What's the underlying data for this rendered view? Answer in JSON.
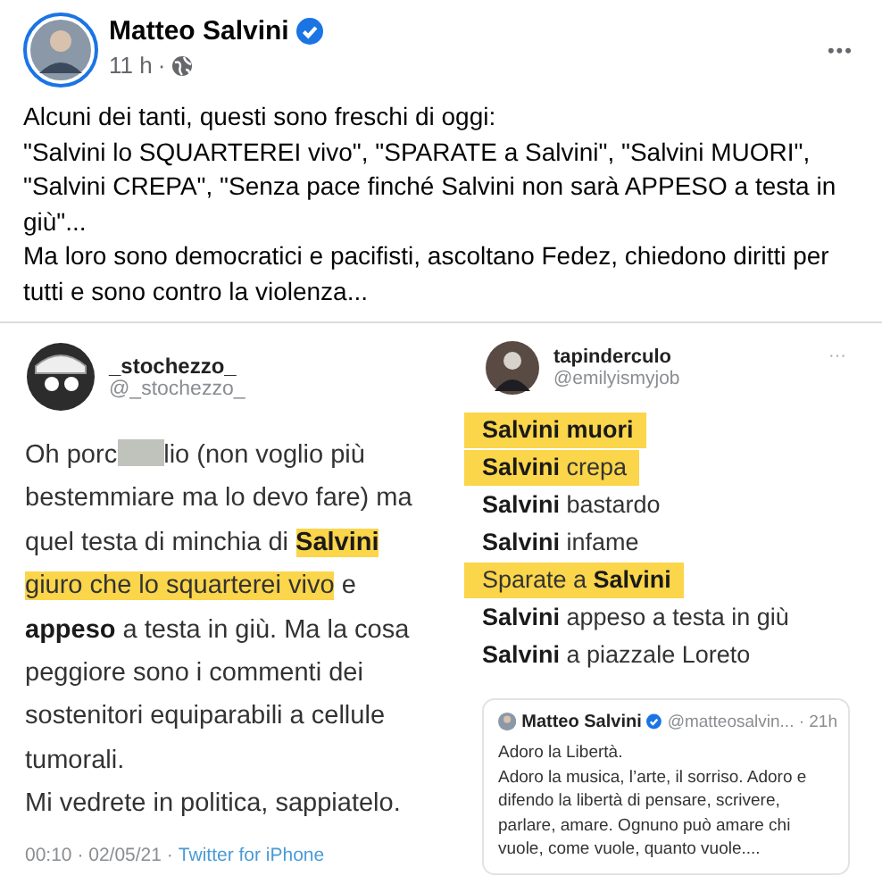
{
  "post": {
    "author": "Matteo Salvini",
    "verified": true,
    "time": "11 h",
    "separator": "·",
    "more": "•••",
    "text": "Alcuni dei tanti, questi sono freschi di oggi:\n\"Salvini lo SQUARTEREI vivo\", \"SPARATE a Salvini\", \"Salvini MUORI\", \"Salvini CREPA\", \"Senza pace finché Salvini non sarà APPESO a testa in giù\"...\nMa loro sono democratici e pacifisti, ascoltano Fedez, chiedono diritti per tutti e sono contro la violenza..."
  },
  "tweets": [
    {
      "name": "_stochezzo_",
      "handle": "@_stochezzo_",
      "paragraphs": [
        [
          {
            "text": "Oh porc"
          },
          {
            "kind": "redaction"
          },
          {
            "text": "lio (non voglio più bestemmiare ma lo devo fare) ma quel testa di minchia di "
          },
          {
            "text": "Salvini",
            "bold": true,
            "highlight": true
          },
          {
            "text": " giuro che lo squarterei vivo",
            "highlight": true
          },
          {
            "text": " e "
          },
          {
            "text": "appeso",
            "bold": true
          },
          {
            "text": " a testa in giù. Ma la cosa peggiore sono i commenti dei sostenitori equiparabili a cellule tumorali."
          }
        ],
        [
          {
            "text": "Mi vedrete in politica, sappiatelo."
          }
        ]
      ],
      "footer": {
        "time": "00:10 · 02/05/21 ·",
        "source": "Twitter for iPhone"
      }
    },
    {
      "name": "tapinderculo",
      "handle": "@emilyismyjob",
      "more": "···",
      "lines": [
        {
          "highlight": true,
          "segments": [
            {
              "text": "Salvini muori",
              "bold": true
            }
          ]
        },
        {
          "highlight": true,
          "segments": [
            {
              "text": "Salvini",
              "bold": true
            },
            {
              "text": " crepa"
            }
          ]
        },
        {
          "highlight": false,
          "segments": [
            {
              "text": "Salvini",
              "bold": true
            },
            {
              "text": " bastardo"
            }
          ]
        },
        {
          "highlight": false,
          "segments": [
            {
              "text": "Salvini",
              "bold": true
            },
            {
              "text": " infame"
            }
          ]
        },
        {
          "highlight": true,
          "segments": [
            {
              "text": "Sparate a "
            },
            {
              "text": "Salvini",
              "bold": true
            }
          ]
        },
        {
          "highlight": false,
          "segments": [
            {
              "text": "Salvini",
              "bold": true
            },
            {
              "text": " appeso a testa in giù"
            }
          ]
        },
        {
          "highlight": false,
          "segments": [
            {
              "text": "Salvini",
              "bold": true
            },
            {
              "text": " a piazzale Loreto"
            }
          ]
        }
      ],
      "quote": {
        "name": "Matteo Salvini",
        "verified": true,
        "meta": "@matteosalvin... · 21h",
        "text": "Adoro la Libertà.\nAdoro la musica, l’arte, il sorriso. Adoro e difendo la libertà di pensare, scrivere, parlare, amare. Ognuno può amare chi vuole, come vuole, quanto vuole...."
      }
    }
  ]
}
